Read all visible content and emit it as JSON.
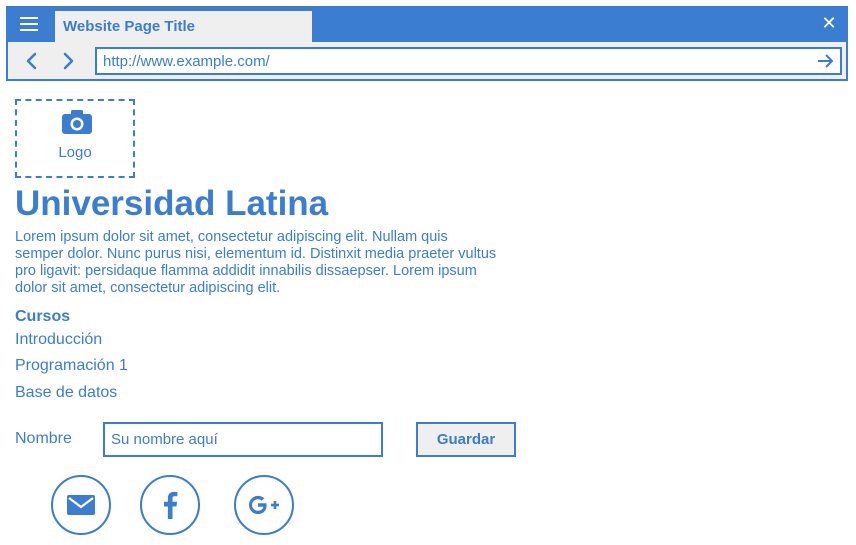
{
  "browser": {
    "tab_title": "Website Page Title",
    "url": "http://www.example.com/",
    "close_glyph": "✕"
  },
  "logo": {
    "label": "Logo",
    "icon": "camera-icon"
  },
  "page": {
    "title": "Universidad Latina",
    "description": "Lorem ipsum dolor sit amet, consectetur adipiscing elit. Nullam quis semper dolor. Nunc purus nisi, elementum id. Distinxit  media praeter vultus pro ligavit: persidaque flamma addidit innabilis dissaepser. Lorem ipsum dolor sit amet, consectetur adipiscing elit."
  },
  "courses": {
    "heading": "Cursos",
    "items": [
      "Introducción",
      "Programación 1",
      "Base de datos"
    ]
  },
  "form": {
    "name_label": "Nombre",
    "name_placeholder": "Su nombre aquí",
    "save_label": "Guardar"
  },
  "social": [
    {
      "icon": "mail-icon"
    },
    {
      "icon": "facebook-icon"
    },
    {
      "icon": "google-plus-icon"
    }
  ],
  "colors": {
    "accent": "#3b7dd0",
    "light_gray": "#efefef",
    "white": "#ffffff"
  }
}
